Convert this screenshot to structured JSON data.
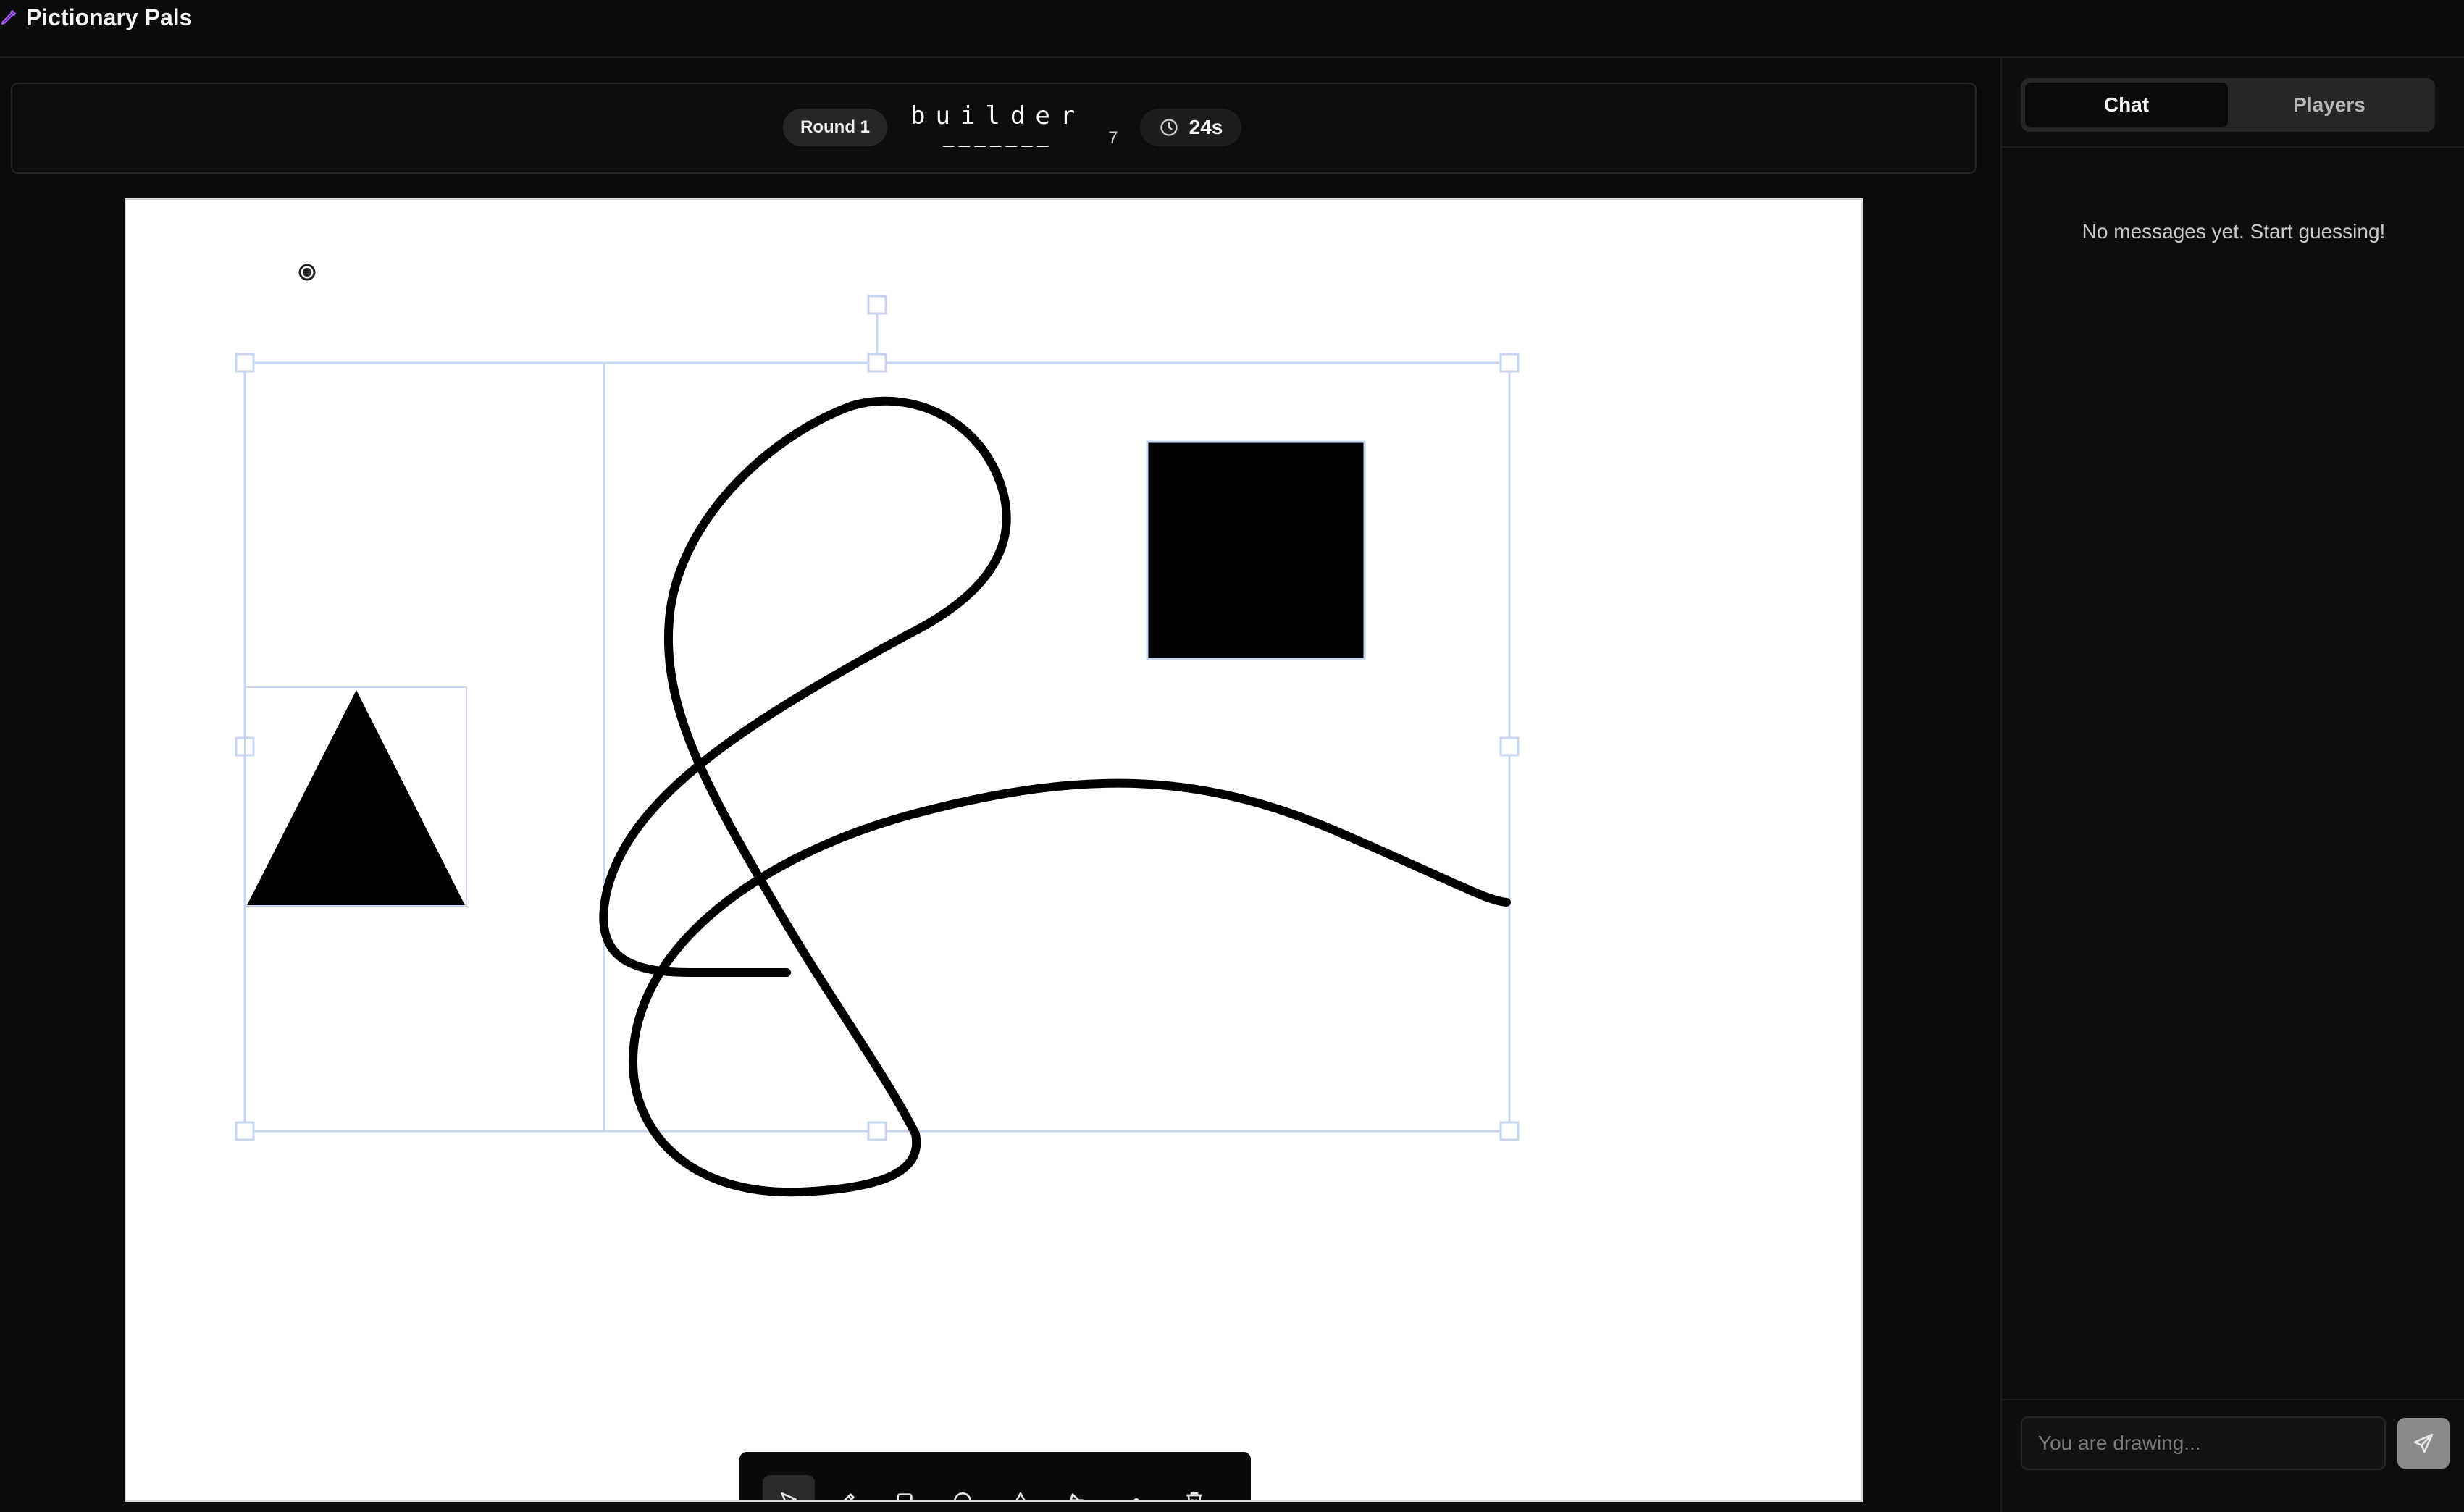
{
  "app": {
    "title": "Pictionary Pals",
    "accent_color": "#a855f7"
  },
  "header": {
    "round_label": "Round 1",
    "word": "builder",
    "word_dashes": "_______",
    "letter_count": "7",
    "timer": "24s"
  },
  "toolbar": {
    "tools": [
      {
        "name": "select-tool",
        "icon": "cursor-arrow-icon",
        "active": true
      },
      {
        "name": "pencil-tool",
        "icon": "pencil-icon",
        "active": false
      },
      {
        "name": "rectangle-tool",
        "icon": "square-icon",
        "active": false
      },
      {
        "name": "circle-tool",
        "icon": "circle-icon",
        "active": false
      },
      {
        "name": "triangle-tool",
        "icon": "triangle-icon",
        "active": false
      },
      {
        "name": "fill-tool",
        "icon": "paint-bucket-icon",
        "active": false
      },
      {
        "name": "brush-size-tool",
        "icon": "small-dot-icon",
        "active": false
      },
      {
        "name": "clear-tool",
        "icon": "trash-icon",
        "active": false
      }
    ]
  },
  "sidebar": {
    "tabs": [
      {
        "label": "Chat",
        "active": true
      },
      {
        "label": "Players",
        "active": false
      }
    ],
    "empty_message": "No messages yet. Start guessing!",
    "input_placeholder": "You are drawing..."
  }
}
